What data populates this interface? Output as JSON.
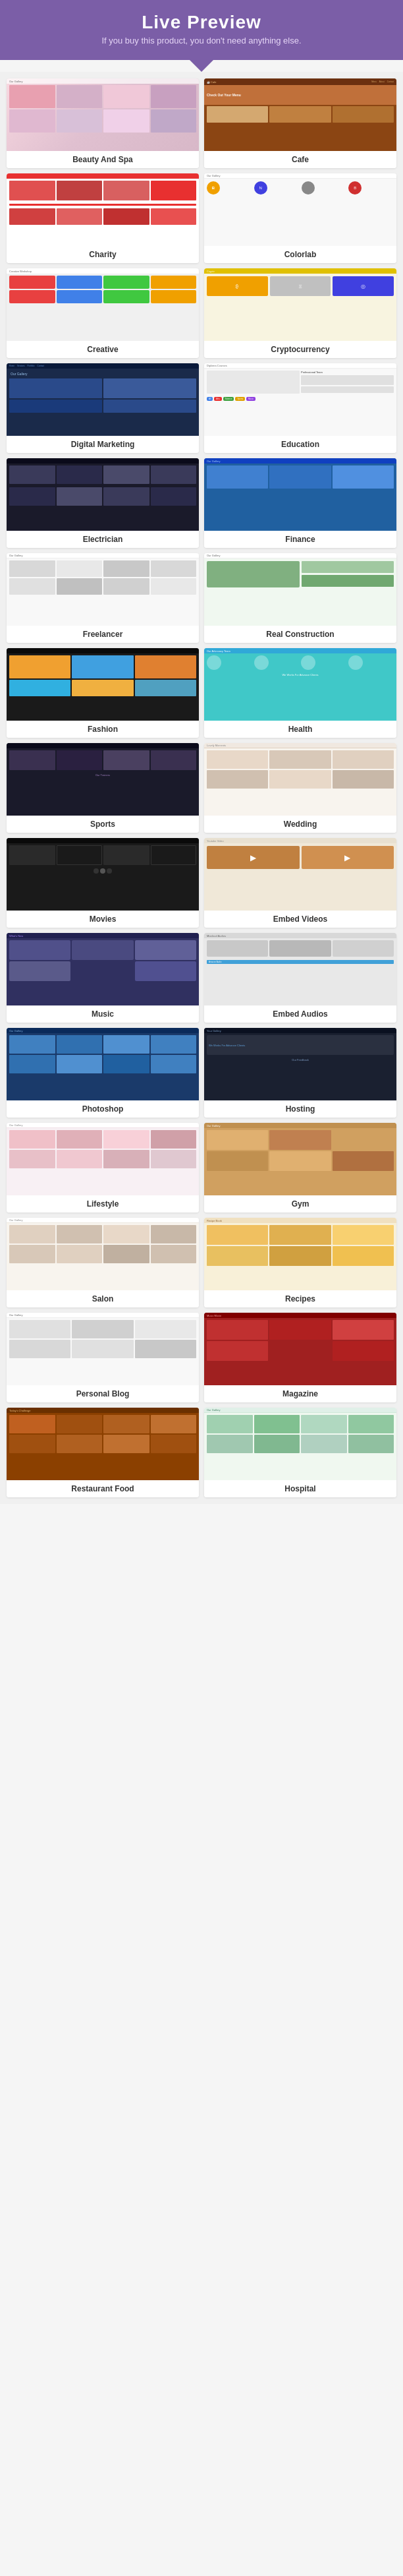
{
  "header": {
    "title": "Live Preview",
    "subtitle": "If you buy this product, you don't need anything else."
  },
  "cards": [
    {
      "id": "beauty-spa",
      "label": "Beauty And Spa",
      "bg": "bg-spa"
    },
    {
      "id": "cafe",
      "label": "Cafe",
      "bg": "bg-cafe"
    },
    {
      "id": "charity",
      "label": "Charity",
      "bg": "bg-charity"
    },
    {
      "id": "colorlab",
      "label": "Colorlab",
      "bg": "bg-colorlab"
    },
    {
      "id": "creative",
      "label": "Creative",
      "bg": "bg-creative"
    },
    {
      "id": "cryptocurrency",
      "label": "Cryptocurrency",
      "bg": "bg-crypto"
    },
    {
      "id": "digital-marketing",
      "label": "Digital Marketing",
      "bg": "bg-digital"
    },
    {
      "id": "education",
      "label": "Education",
      "bg": "bg-education"
    },
    {
      "id": "electrician",
      "label": "Electrician",
      "bg": "bg-electrician"
    },
    {
      "id": "finance",
      "label": "Finance",
      "bg": "bg-finance"
    },
    {
      "id": "freelancer",
      "label": "Freelancer",
      "bg": "bg-freelancer"
    },
    {
      "id": "real-construction",
      "label": "Real Construction",
      "bg": "bg-construction"
    },
    {
      "id": "fashion",
      "label": "Fashion",
      "bg": "bg-fashion"
    },
    {
      "id": "health",
      "label": "Health",
      "bg": "bg-health"
    },
    {
      "id": "sports",
      "label": "Sports",
      "bg": "bg-sports"
    },
    {
      "id": "wedding",
      "label": "Wedding",
      "bg": "bg-wedding"
    },
    {
      "id": "movies",
      "label": "Movies",
      "bg": "bg-movies"
    },
    {
      "id": "embed-videos",
      "label": "Embed Videos",
      "bg": "bg-embed"
    },
    {
      "id": "music",
      "label": "Music",
      "bg": "bg-music"
    },
    {
      "id": "embed-audios",
      "label": "Embed Audios",
      "bg": "bg-audios"
    },
    {
      "id": "photoshop",
      "label": "Photoshop",
      "bg": "bg-photoshop"
    },
    {
      "id": "hosting",
      "label": "Hosting",
      "bg": "bg-hosting"
    },
    {
      "id": "lifestyle",
      "label": "Lifestyle",
      "bg": "bg-lifestyle"
    },
    {
      "id": "gym",
      "label": "Gym",
      "bg": "bg-gym"
    },
    {
      "id": "salon",
      "label": "Salon",
      "bg": "bg-salon"
    },
    {
      "id": "recipes",
      "label": "Recipes",
      "bg": "bg-recipes"
    },
    {
      "id": "personal-blog",
      "label": "Personal Blog",
      "bg": "bg-blog"
    },
    {
      "id": "magazine",
      "label": "Magazine",
      "bg": "bg-magazine"
    },
    {
      "id": "restaurant-food",
      "label": "Restaurant Food",
      "bg": "bg-restaurant"
    },
    {
      "id": "hospital",
      "label": "Hospital",
      "bg": "bg-hospital"
    }
  ]
}
